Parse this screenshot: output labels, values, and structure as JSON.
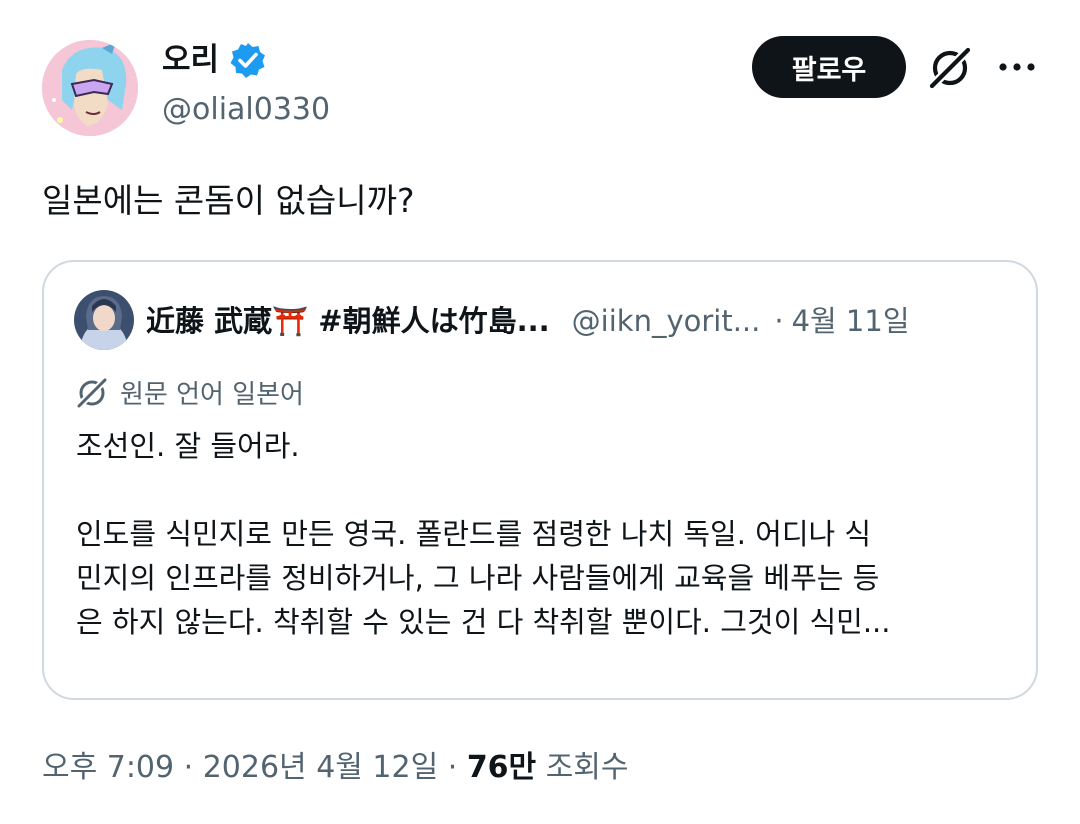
{
  "author": {
    "display_name": "오리",
    "handle": "@olial0330"
  },
  "actions": {
    "follow_label": "팔로우"
  },
  "tweet": {
    "text": "일본에는 콘돔이 없습니까?"
  },
  "quote": {
    "name": "近藤 武蔵⛩️ #朝鮮人は竹島...",
    "handle": "@iikn_yorit...",
    "separator": "·",
    "date": "4월 11일",
    "translate_label": "원문 언어 일본어",
    "lines": [
      "조선인. 잘 들어라.",
      "",
      "인도를 식민지로 만든 영국. 폴란드를 점령한 나치 독일. 어디나 식",
      "민지의 인프라를 정비하거나, 그 나라 사람들에게 교육을 베푸는 등",
      "은 하지 않는다. 착취할 수 있는 건 다 착취할 뿐이다. 그것이 식민..."
    ]
  },
  "meta": {
    "time_date": "오후 7:09 · 2026년 4월 12일 · ",
    "views_count": "76만",
    "views_label": " 조회수"
  },
  "colors": {
    "text": "#0f1419",
    "muted": "#536471",
    "border": "#cfd9de",
    "verified": "#1d9bf0",
    "follow_bg": "#0f1419"
  },
  "icons": {
    "verified": "verified-badge-icon",
    "grok": "grok-icon",
    "more": "more-icon",
    "translate": "translate-icon"
  }
}
